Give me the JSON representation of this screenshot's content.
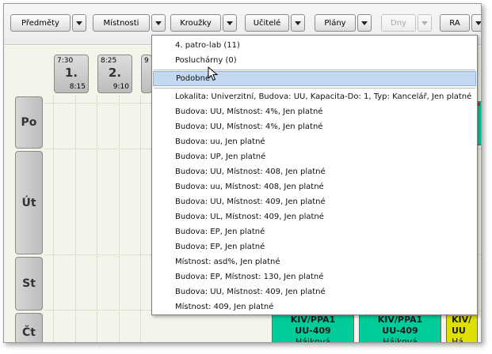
{
  "toolbar": {
    "subjects_label": "Předměty",
    "rooms_label": "Místnosti",
    "groups_label": "Kroužky",
    "teachers_label": "Učitelé",
    "plans_label": "Plány",
    "days_label": "Dny",
    "ra_label": "RA"
  },
  "hours": [
    {
      "start": "7:30",
      "number": "1.",
      "end": "8:15"
    },
    {
      "start": "8:25",
      "number": "2.",
      "end": "9:10"
    },
    {
      "start": "9",
      "number": "",
      "end": ""
    }
  ],
  "days": [
    "Po",
    "Út",
    "St",
    "Čt"
  ],
  "dropdown": {
    "items": [
      "4. patro-lab (11)",
      "Posluchárny (0)",
      "Podobné",
      "Lokalita: Univerzitní, Budova: UU, Kapacita-Do: 1, Typ: Kancelář, Jen platné",
      "Budova: UU, Místnost: 4%, Jen platné",
      "Budova: UU, Místnost: 4%, Jen platné",
      "Budova: uu, Jen platné",
      "Budova: UP, Jen platné",
      "Budova: UU, Místnost: 408, Jen platné",
      "Budova: uu, Místnost: 408, Jen platné",
      "Budova: UU, Místnost: 409, Jen platné",
      "Budova: UL, Místnost: 409, Jen platné",
      "Budova: EP, Jen platné",
      "Budova: EP, Jen platné",
      "Místnost: asd%, Jen platné",
      "Budova: EP, Místnost: 130, Jen platné",
      "Budova: UU, Místnost: 409, Jen platné",
      "Místnost: 409, Jen platné"
    ],
    "selected_index": 2
  },
  "schedule": [
    {
      "code": "KIV/PPA1",
      "room": "UU-409",
      "teacher": "Hájková"
    },
    {
      "code": "KIV/PPA1",
      "room": "UU-409",
      "teacher": "Hájková"
    },
    {
      "code": "KIV/",
      "room": "UU",
      "teacher": "Há"
    }
  ],
  "colors": {
    "cell_green": "#00cc99",
    "cell_yellow": "#e0e000",
    "selection": "#c3d9f2"
  }
}
